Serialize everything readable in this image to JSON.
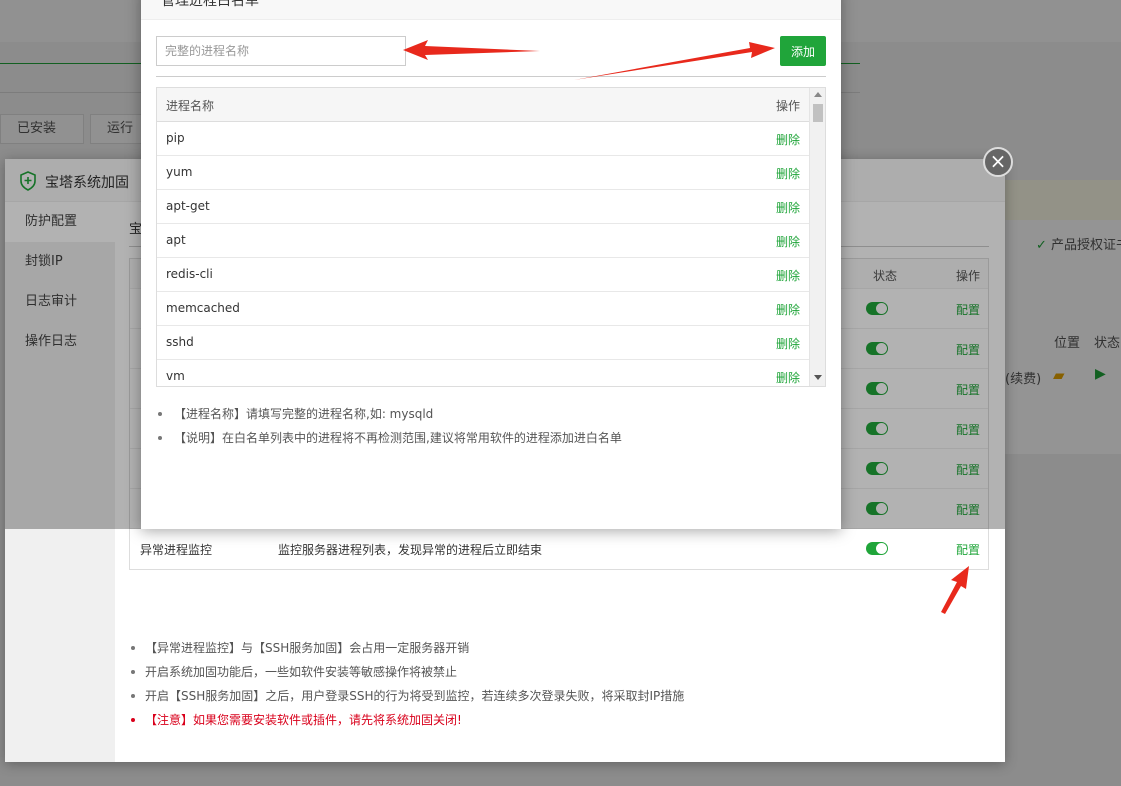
{
  "background": {
    "tabs": [
      "已安装",
      "运行环"
    ],
    "right_links": [
      "产品授权证书"
    ],
    "right_table_headers": [
      "位置",
      "状态"
    ],
    "renew_text": "(续费)"
  },
  "security_layer": {
    "title": "宝塔系统加固",
    "sidebar": [
      {
        "label": "防护配置",
        "active": true
      },
      {
        "label": "封锁IP",
        "active": false
      },
      {
        "label": "日志审计",
        "active": false
      },
      {
        "label": "操作日志",
        "active": false
      }
    ],
    "main_title": "宝",
    "table": {
      "headers": {
        "status": "状态",
        "action": "操作"
      },
      "rows": [
        {
          "name": "",
          "desc": "",
          "action": "配置"
        },
        {
          "name": "",
          "desc": "",
          "action": "配置"
        },
        {
          "name": "",
          "desc": "",
          "action": "配置"
        },
        {
          "name": "",
          "desc": "",
          "action": "配置"
        },
        {
          "name": "",
          "desc": "",
          "action": "配置"
        },
        {
          "name": "",
          "desc": "",
          "action": "配置"
        },
        {
          "name": "异常进程监控",
          "desc": "监控服务器进程列表，发现异常的进程后立即结束",
          "action": "配置"
        }
      ]
    },
    "notes": [
      {
        "text": "【异常进程监控】与【SSH服务加固】会占用一定服务器开销",
        "warn": false
      },
      {
        "text": "开启系统加固功能后，一些如软件安装等敏感操作将被禁止",
        "warn": false
      },
      {
        "text": "开启【SSH服务加固】之后，用户登录SSH的行为将受到监控，若连续多次登录失败，将采取封IP措施",
        "warn": false
      },
      {
        "text": "【注意】如果您需要安装软件或插件，请先将系统加固关闭!",
        "warn": true
      }
    ]
  },
  "whitelist_dialog": {
    "title": "管理进程白名单",
    "input": {
      "placeholder": "完整的进程名称",
      "value": ""
    },
    "add_label": "添加",
    "table": {
      "headers": {
        "name": "进程名称",
        "action": "操作"
      },
      "rows": [
        {
          "name": "pip",
          "action": "删除"
        },
        {
          "name": "yum",
          "action": "删除"
        },
        {
          "name": "apt-get",
          "action": "删除"
        },
        {
          "name": "apt",
          "action": "删除"
        },
        {
          "name": "redis-cli",
          "action": "删除"
        },
        {
          "name": "memcached",
          "action": "删除"
        },
        {
          "name": "sshd",
          "action": "删除"
        },
        {
          "name": "vm",
          "action": "删除"
        }
      ]
    },
    "notes": [
      "【进程名称】请填写完整的进程名称,如: mysqld",
      "【说明】在白名单列表中的进程将不再检测范围,建议将常用软件的进程添加进白名单"
    ]
  },
  "colors": {
    "accent": "#20a53a",
    "warn": "#d9001b",
    "arrow": "#e8291c"
  }
}
